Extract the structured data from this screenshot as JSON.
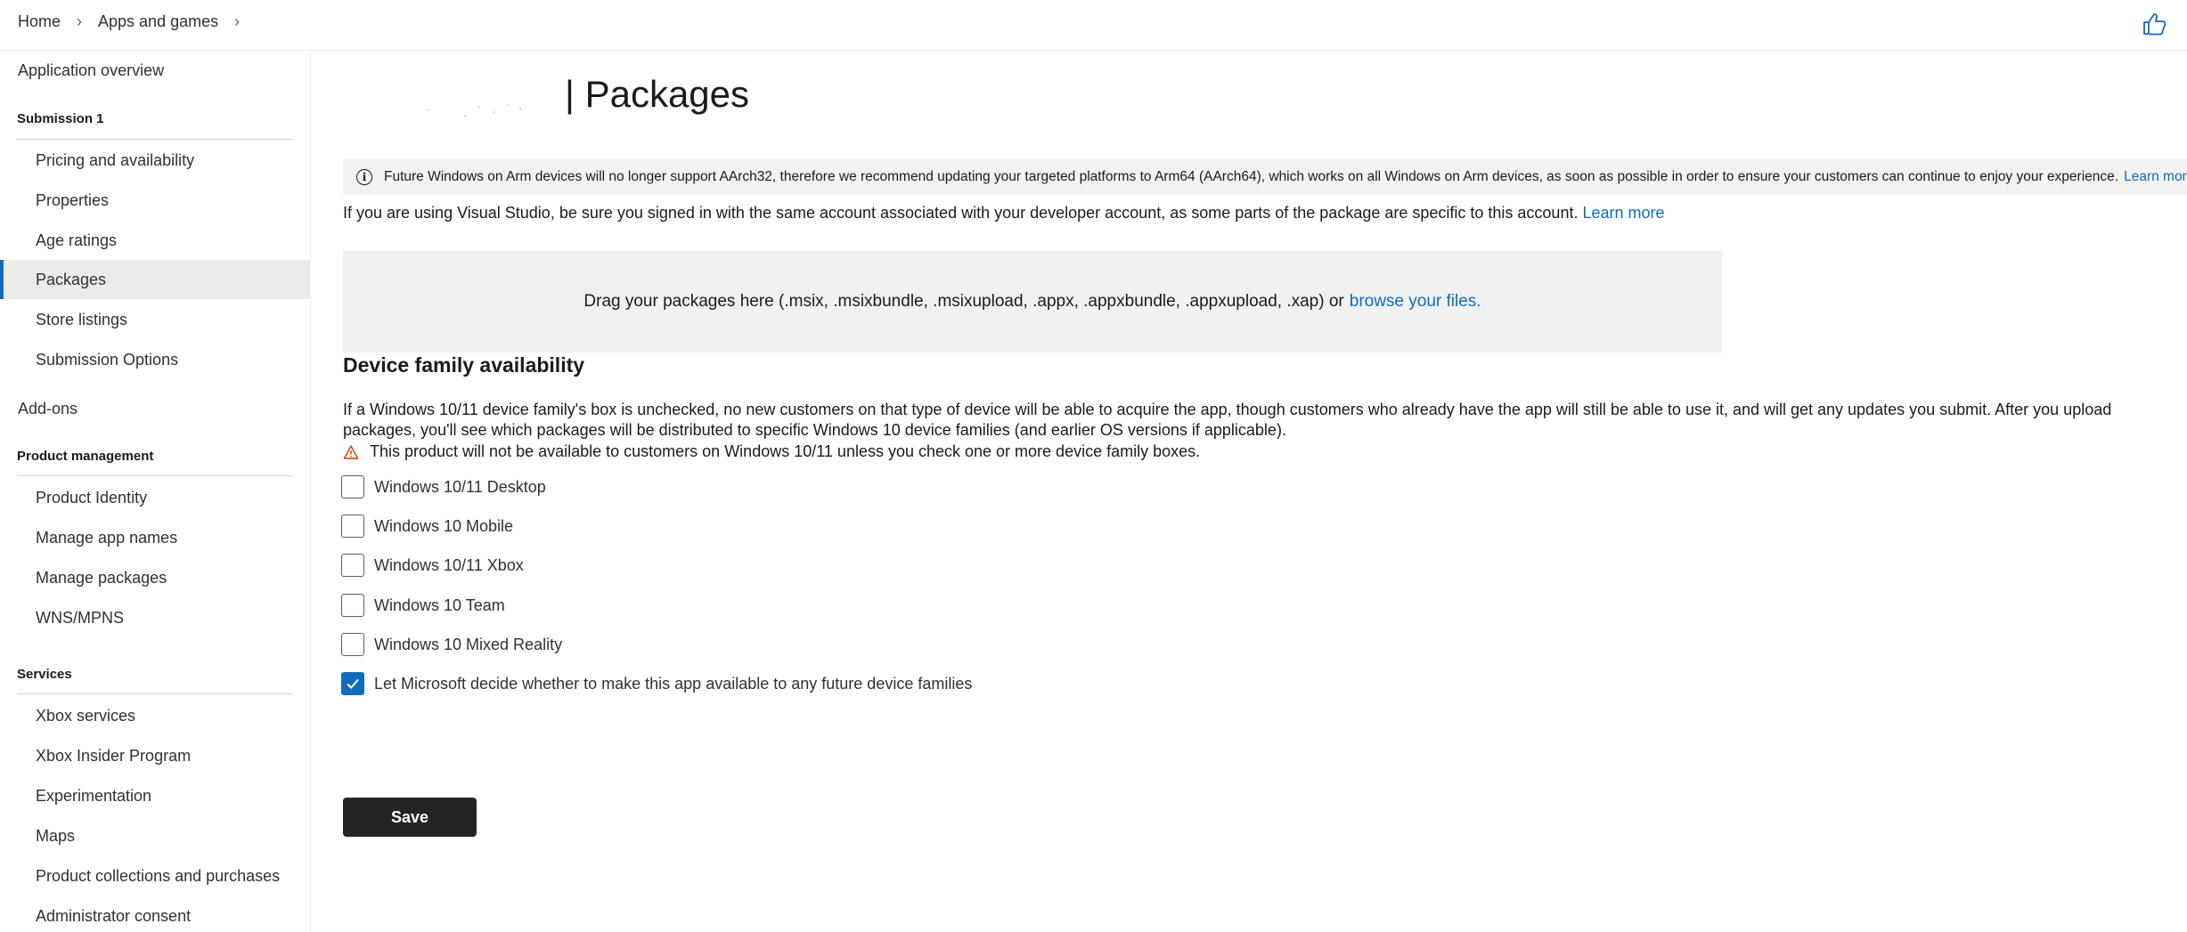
{
  "breadcrumb": {
    "items": [
      "Home",
      "Apps and games"
    ]
  },
  "header": {
    "feedback_icon": "thumbs-up-icon"
  },
  "sidebar": {
    "application_overview": "Application overview",
    "submission_header": "Submission 1",
    "submission_items": [
      "Pricing and availability",
      "Properties",
      "Age ratings",
      "Packages",
      "Store listings",
      "Submission Options"
    ],
    "active_item": "Packages",
    "addons": "Add-ons",
    "product_management_header": "Product management",
    "product_management_items": [
      "Product Identity",
      "Manage app names",
      "Manage packages",
      "WNS/MPNS"
    ],
    "services_header": "Services",
    "services_items": [
      "Xbox services",
      "Xbox Insider Program",
      "Experimentation",
      "Maps",
      "Product collections and purchases",
      "Administrator consent"
    ]
  },
  "main": {
    "page_title": "| Packages",
    "info_banner": {
      "text": "Future Windows on Arm devices will no longer support AArch32, therefore we recommend updating your targeted platforms to Arm64 (AArch64), which works on all Windows on Arm devices, as soon as possible in order to ensure your customers can continue to enjoy your experience.",
      "link": "Learn more"
    },
    "vs_note": {
      "text": "If you are using Visual Studio, be sure you signed in with the same account associated with your developer account, as some parts of the package are specific to this account.",
      "link": "Learn more"
    },
    "dropzone": {
      "text": "Drag your packages here (.msix, .msixbundle, .msixupload, .appx, .appxbundle, .appxupload, .xap) or",
      "link": "browse your files."
    },
    "device_family": {
      "title": "Device family availability",
      "description": "If a Windows 10/11 device family's box is unchecked, no new customers on that type of device will be able to acquire the app, though customers who already have the app will still be able to use it, and will get any updates you submit. After you upload packages, you'll see which packages will be distributed to specific Windows 10 device families (and earlier OS versions if applicable).",
      "warning": "This product will not be available to customers on Windows 10/11 unless you check one or more device family boxes.",
      "options": [
        {
          "label": "Windows 10/11 Desktop",
          "checked": false
        },
        {
          "label": "Windows 10 Mobile",
          "checked": false
        },
        {
          "label": "Windows 10/11 Xbox",
          "checked": false
        },
        {
          "label": "Windows 10 Team",
          "checked": false
        },
        {
          "label": "Windows 10 Mixed Reality",
          "checked": false
        },
        {
          "label": "Let Microsoft decide whether to make this app available to any future device families",
          "checked": true
        }
      ]
    },
    "save_label": "Save"
  },
  "colors": {
    "accent": "#0f6cbd",
    "save_button": "#242424",
    "banner_bg": "#f3f2f1",
    "dropzone_bg": "#f1f1f1"
  }
}
